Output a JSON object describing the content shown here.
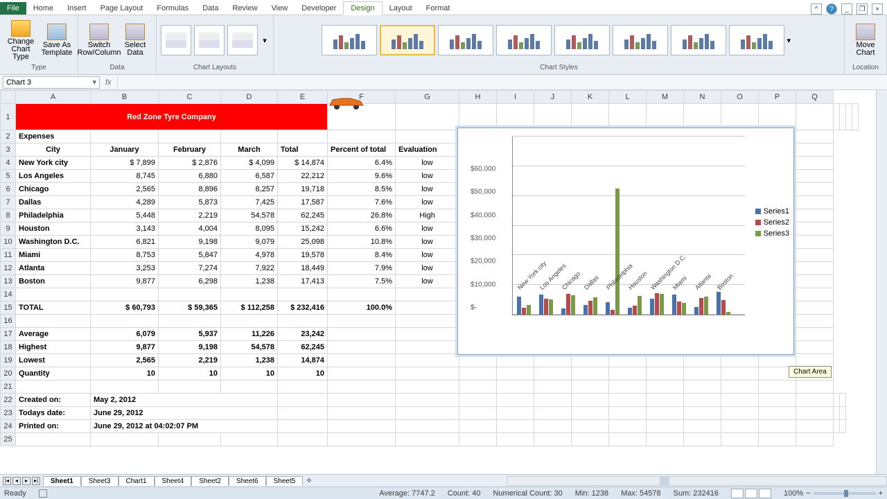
{
  "tabs": {
    "file": "File",
    "home": "Home",
    "insert": "Insert",
    "page": "Page Layout",
    "formulas": "Formulas",
    "data": "Data",
    "review": "Review",
    "view": "View",
    "developer": "Developer",
    "design": "Design",
    "layout": "Layout",
    "format": "Format"
  },
  "ribbon": {
    "change_type": "Change Chart Type",
    "save_template": "Save As Template",
    "type_label": "Type",
    "switch": "Switch Row/Column",
    "select_data": "Select Data",
    "data_label": "Data",
    "layouts_label": "Chart Layouts",
    "styles_label": "Chart Styles",
    "move_chart": "Move Chart",
    "location_label": "Location"
  },
  "namebox": "Chart 3",
  "company": "Red Zone Tyre Company",
  "headers": {
    "expenses": "Expenses",
    "city": "City",
    "jan": "January",
    "feb": "February",
    "mar": "March",
    "total": "Total",
    "pct": "Percent of total",
    "eval": "Evaluation"
  },
  "rows": [
    {
      "city": "New York city",
      "jan": "7,899",
      "feb": "2,876",
      "mar": "4,099",
      "total": "14,874",
      "pct": "6.4%",
      "eval": "low"
    },
    {
      "city": "Los Angeles",
      "jan": "8,745",
      "feb": "6,880",
      "mar": "6,587",
      "total": "22,212",
      "pct": "9.6%",
      "eval": "low"
    },
    {
      "city": "Chicago",
      "jan": "2,565",
      "feb": "8,896",
      "mar": "8,257",
      "total": "19,718",
      "pct": "8.5%",
      "eval": "low"
    },
    {
      "city": "Dallas",
      "jan": "4,289",
      "feb": "5,873",
      "mar": "7,425",
      "total": "17,587",
      "pct": "7.6%",
      "eval": "low"
    },
    {
      "city": "Philadelphia",
      "jan": "5,448",
      "feb": "2,219",
      "mar": "54,578",
      "total": "62,245",
      "pct": "26.8%",
      "eval": "High"
    },
    {
      "city": "Houston",
      "jan": "3,143",
      "feb": "4,004",
      "mar": "8,095",
      "total": "15,242",
      "pct": "6.6%",
      "eval": "low"
    },
    {
      "city": "Washington D.C.",
      "jan": "6,821",
      "feb": "9,198",
      "mar": "9,079",
      "total": "25,098",
      "pct": "10.8%",
      "eval": "low"
    },
    {
      "city": "Miami",
      "jan": "8,753",
      "feb": "5,847",
      "mar": "4,978",
      "total": "19,578",
      "pct": "8.4%",
      "eval": "low"
    },
    {
      "city": "Atlanta",
      "jan": "3,253",
      "feb": "7,274",
      "mar": "7,922",
      "total": "18,449",
      "pct": "7.9%",
      "eval": "low"
    },
    {
      "city": "Boston",
      "jan": "9,877",
      "feb": "6,298",
      "mar": "1,238",
      "total": "17,413",
      "pct": "7.5%",
      "eval": "low"
    }
  ],
  "totals": {
    "label": "TOTAL",
    "jan": "60,793",
    "feb": "59,365",
    "mar": "112,258",
    "total": "232,416",
    "pct": "100.0%"
  },
  "summary": [
    {
      "label": "Average",
      "jan": "6,079",
      "feb": "5,937",
      "mar": "11,226",
      "total": "23,242"
    },
    {
      "label": "Highest",
      "jan": "9,877",
      "feb": "9,198",
      "mar": "54,578",
      "total": "62,245"
    },
    {
      "label": "Lowest",
      "jan": "2,565",
      "feb": "2,219",
      "mar": "1,238",
      "total": "14,874"
    },
    {
      "label": "Quantity",
      "jan": "10",
      "feb": "10",
      "mar": "10",
      "total": "10"
    }
  ],
  "meta": [
    {
      "label": "Created on:",
      "val": "May 2, 2012"
    },
    {
      "label": "Todays date:",
      "val": "June 29, 2012"
    },
    {
      "label": "Printed on:",
      "val": "June 29, 2012 at 04:02:07 PM"
    }
  ],
  "chart_tooltip": "Chart Area",
  "chart_data": {
    "type": "bar",
    "categories": [
      "New York city",
      "Los Angeles",
      "Chicago",
      "Dallas",
      "Philadelphia",
      "Houston",
      "Washington D.C.",
      "Miami",
      "Atlanta",
      "Boston"
    ],
    "series": [
      {
        "name": "Series1",
        "values": [
          7899,
          8745,
          2565,
          4289,
          5448,
          3143,
          6821,
          8753,
          3253,
          9877
        ]
      },
      {
        "name": "Series2",
        "values": [
          2876,
          6880,
          8896,
          5873,
          2219,
          4004,
          9198,
          5847,
          7274,
          6298
        ]
      },
      {
        "name": "Series3",
        "values": [
          4099,
          6587,
          8257,
          7425,
          54578,
          8095,
          9079,
          4978,
          7922,
          1238
        ]
      }
    ],
    "ylim": [
      0,
      60000
    ],
    "yticks": [
      "$-",
      "$10,000",
      "$20,000",
      "$30,000",
      "$40,000",
      "$50,000",
      "$60,000"
    ],
    "legend": [
      "Series1",
      "Series2",
      "Series3"
    ]
  },
  "sheets": [
    "Sheet1",
    "Sheet3",
    "Chart1",
    "Sheet4",
    "Sheet2",
    "Sheet6",
    "Sheet5"
  ],
  "status": {
    "ready": "Ready",
    "avg": "Average: 7747.2",
    "count": "Count: 40",
    "ncount": "Numerical Count: 30",
    "min": "Min: 1238",
    "max": "Max: 54578",
    "sum": "Sum: 232416",
    "zoom": "100%"
  },
  "cols": [
    "A",
    "B",
    "C",
    "D",
    "E",
    "F",
    "G",
    "H",
    "I",
    "J",
    "K",
    "L",
    "M",
    "N",
    "O",
    "P",
    "Q"
  ],
  "dollar": "$"
}
